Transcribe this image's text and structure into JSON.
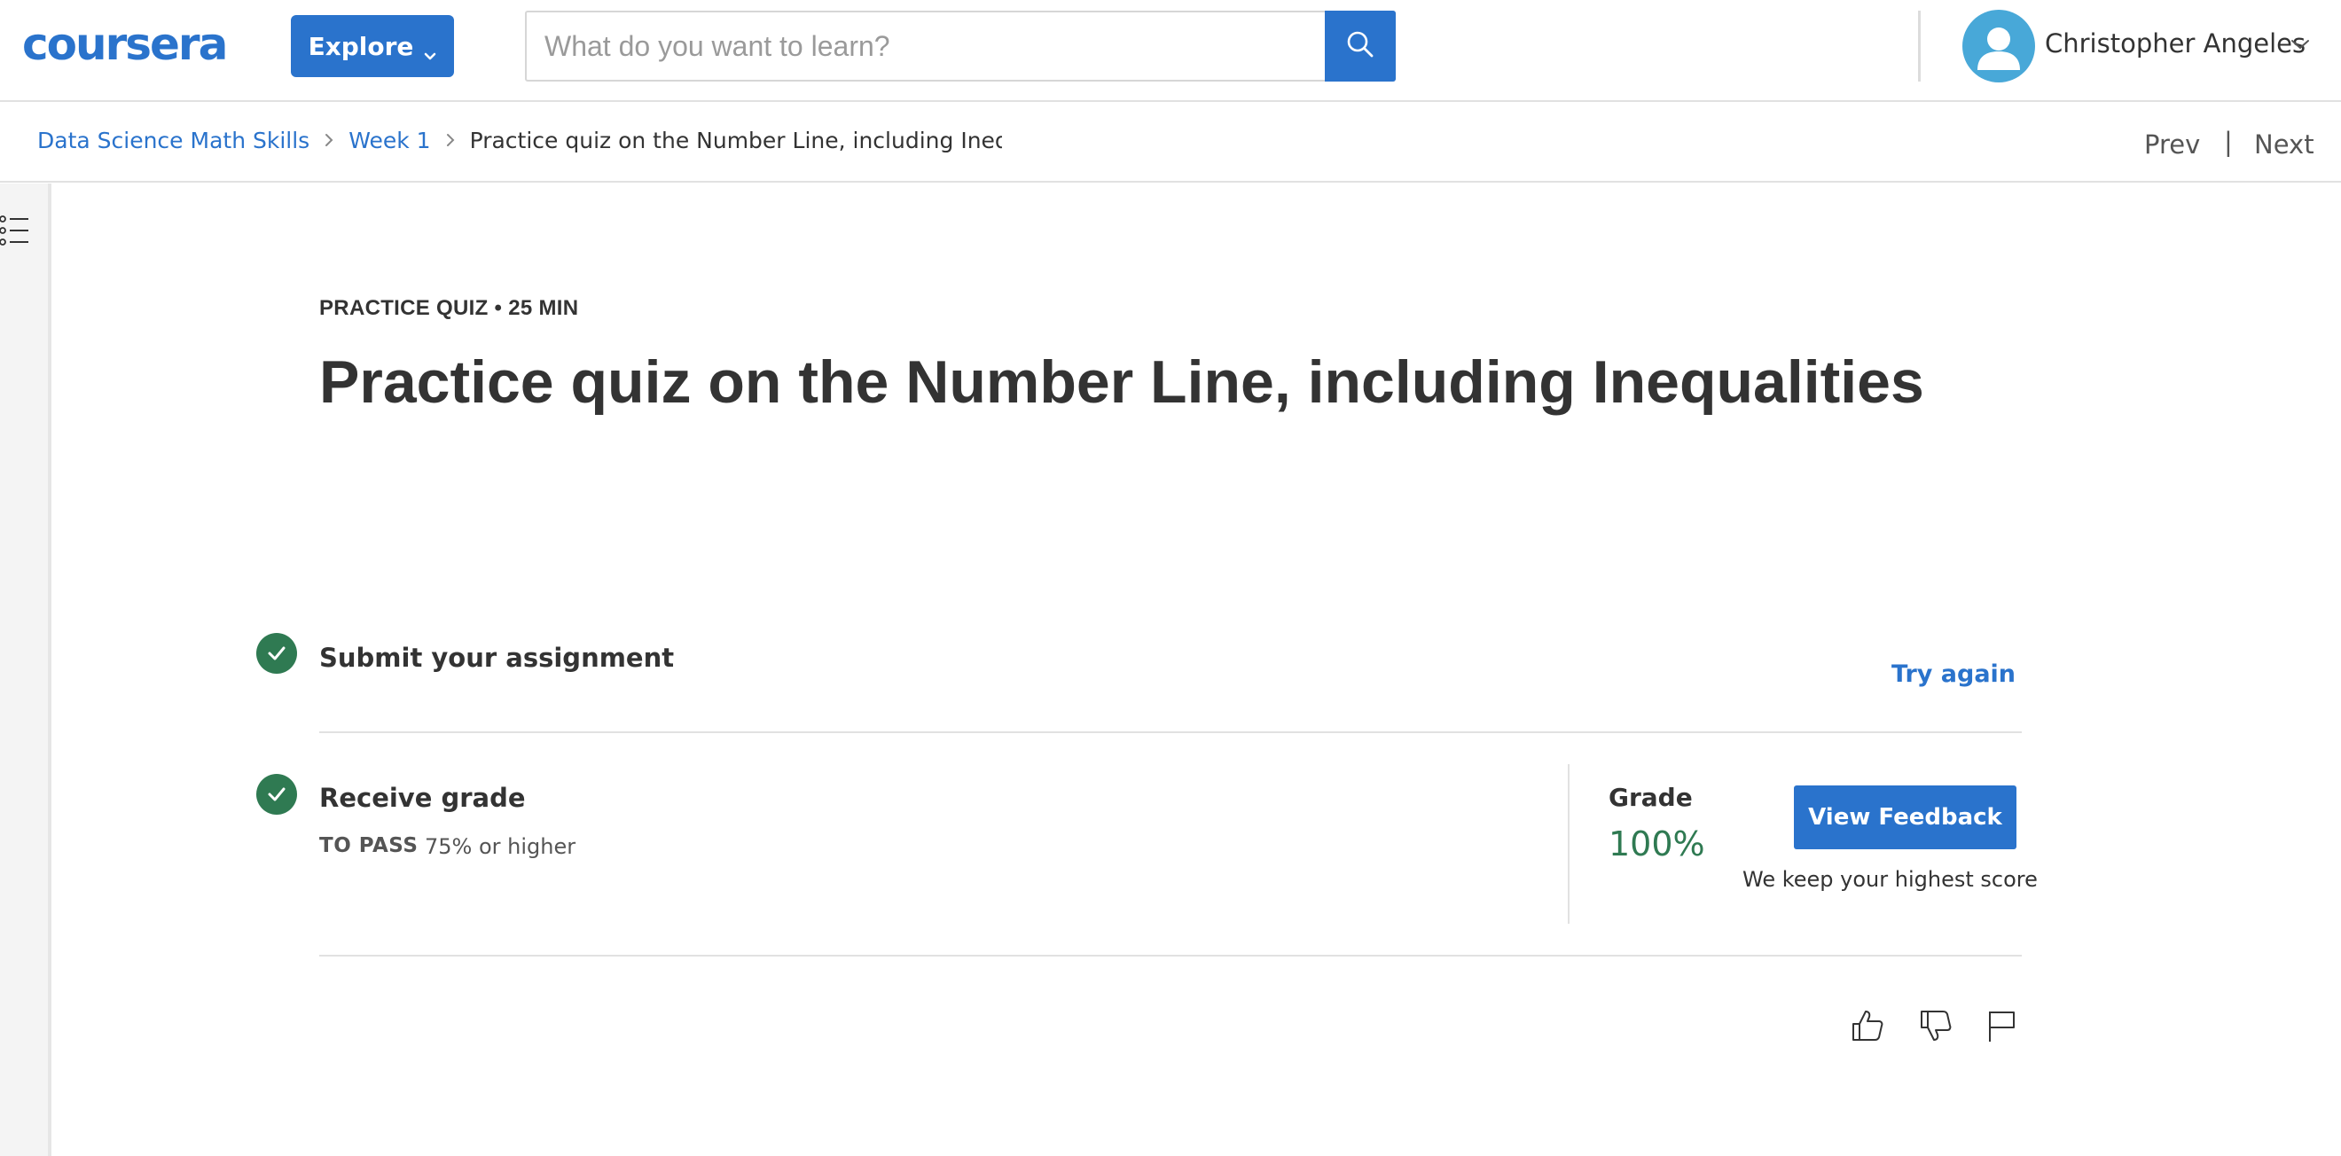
{
  "header": {
    "logo_text": "coursera",
    "explore_label": "Explore",
    "search": {
      "placeholder": "What do you want to learn?",
      "value": ""
    },
    "user": {
      "name": "Christopher Angeles"
    }
  },
  "breadcrumb": {
    "items": [
      "Data Science Math Skills",
      "Week 1"
    ],
    "current": "Practice quiz on the Number Line, including Inequaliti"
  },
  "nav": {
    "prev_label": "Prev",
    "separator": "|",
    "next_label": "Next"
  },
  "quiz": {
    "eyebrow": "PRACTICE QUIZ • 25 MIN",
    "title": "Practice quiz on the Number Line, including Inequalities",
    "submit_step": {
      "title": "Submit your assignment",
      "action_label": "Try again"
    },
    "grade_step": {
      "title": "Receive grade",
      "pass_label": "TO PASS",
      "pass_value": "75% or higher",
      "grade_label": "Grade",
      "grade_value": "100%",
      "feedback_button": "View Feedback",
      "note": "We keep your highest score"
    }
  },
  "icons": {
    "search": "search-icon",
    "menu": "list-icon",
    "user": "user-avatar-icon",
    "like": "thumbs-up-icon",
    "dislike": "thumbs-down-icon",
    "flag": "flag-icon"
  },
  "colors": {
    "brand_blue": "#2a73cc",
    "success_green": "#2f7a52",
    "avatar_blue": "#48a8d8",
    "text_dark": "#333333"
  }
}
